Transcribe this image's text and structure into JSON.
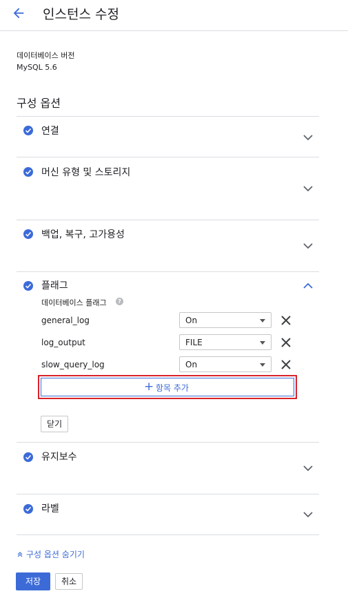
{
  "header": {
    "title": "인스턴스 수정"
  },
  "database_version": {
    "label": "데이터베이스 버전",
    "value": "MySQL 5.6"
  },
  "config": {
    "title": "구성 옵션",
    "sections": [
      {
        "title": "연결",
        "expanded": false
      },
      {
        "title": "머신 유형 및 스토리지",
        "expanded": false
      },
      {
        "title": "백업, 복구, 고가용성",
        "expanded": false
      },
      {
        "title": "플래그",
        "expanded": true
      },
      {
        "title": "유지보수",
        "expanded": false
      },
      {
        "title": "라벨",
        "expanded": false
      }
    ]
  },
  "flags": {
    "subtitle": "데이터베이스 플래그",
    "help_icon": "?",
    "rows": [
      {
        "name": "general_log",
        "value": "On"
      },
      {
        "name": "log_output",
        "value": "FILE"
      },
      {
        "name": "slow_query_log",
        "value": "On"
      }
    ],
    "add_label": "항목 추가",
    "close_label": "닫기"
  },
  "footer": {
    "hide_options": "구성 옵션 숨기기",
    "save": "저장",
    "cancel": "취소"
  },
  "colors": {
    "accent": "#3c6bd8",
    "highlight": "#d92128",
    "divider": "#dadce0"
  }
}
